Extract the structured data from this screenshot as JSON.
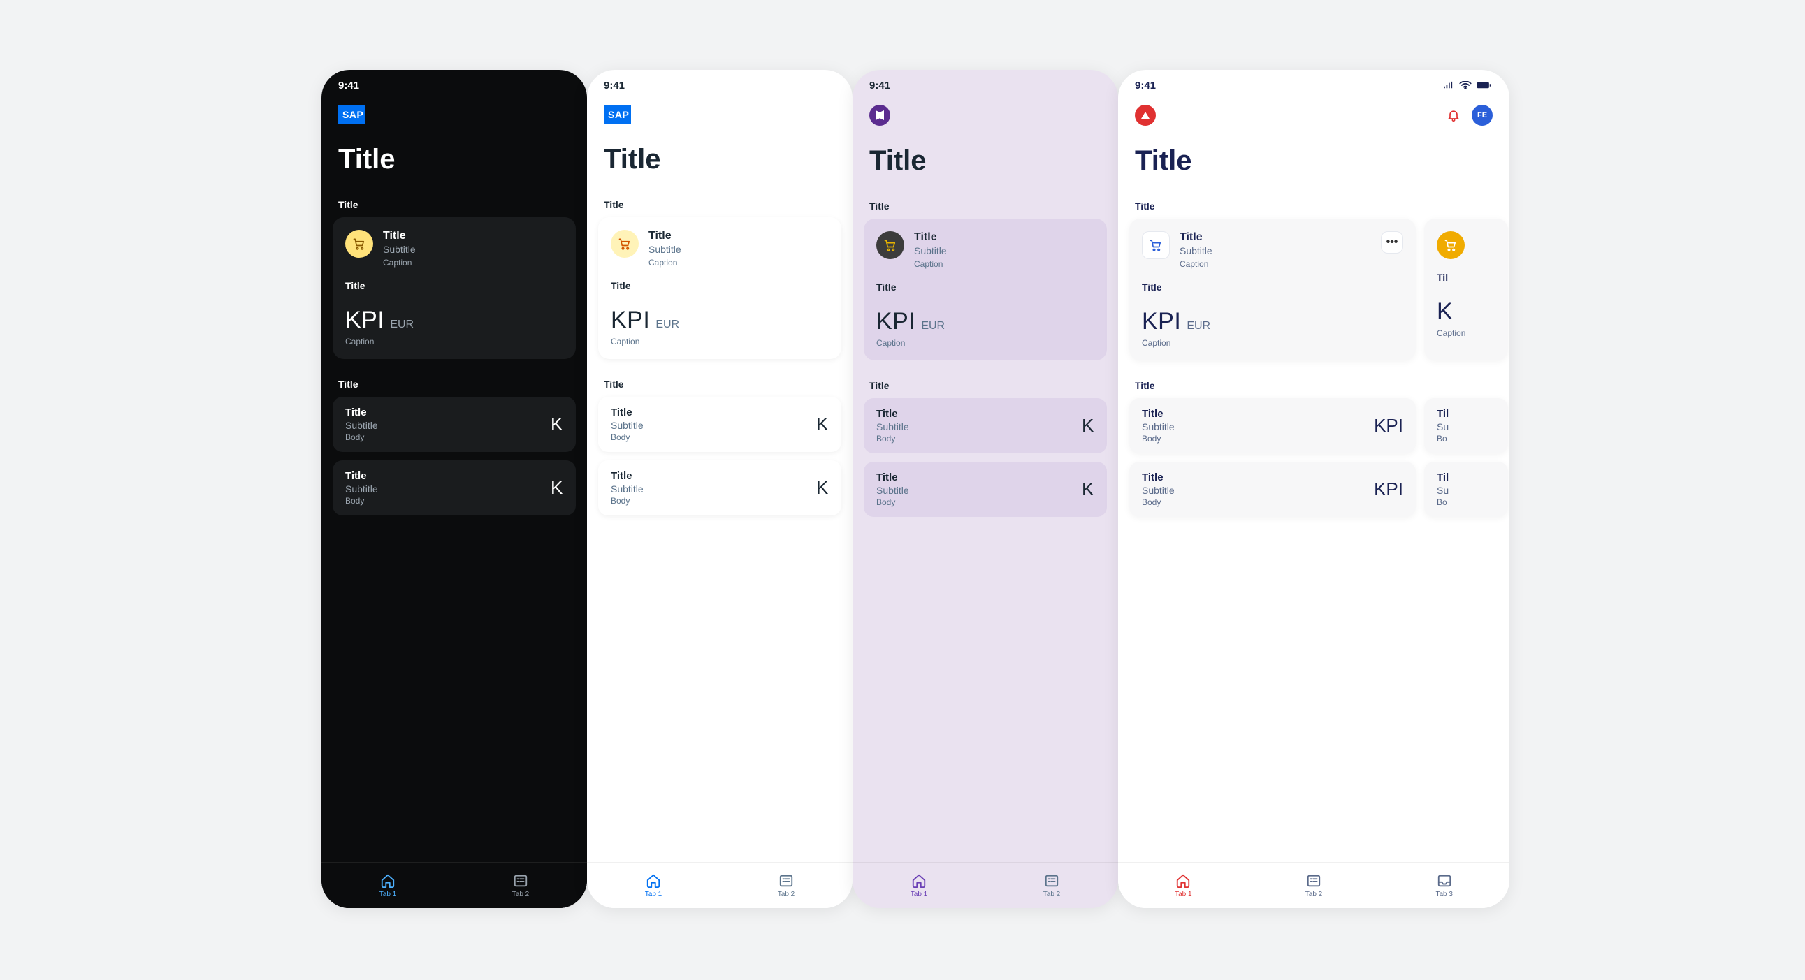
{
  "status_time": "9:41",
  "page_title": "Title",
  "avatar_initials": "FE",
  "logos": {
    "sap_text": "SAP"
  },
  "section1": {
    "title": "Title",
    "card": {
      "title": "Title",
      "subtitle": "Subtitle",
      "caption": "Caption"
    },
    "kpi": {
      "title": "Title",
      "value": "KPI",
      "unit": "EUR",
      "caption": "Caption"
    }
  },
  "section2": {
    "title": "Title",
    "items": [
      {
        "title": "Title",
        "subtitle": "Subtitle",
        "body": "Body",
        "kpi": "KPI"
      },
      {
        "title": "Title",
        "subtitle": "Subtitle",
        "body": "Body",
        "kpi": "KPI"
      }
    ]
  },
  "peek": {
    "title": "Til",
    "subtitle": "Su",
    "body": "Bo",
    "kpi_letter": "K"
  },
  "tabs2": [
    {
      "label": "Tab 1",
      "icon": "home",
      "active": true
    },
    {
      "label": "Tab 2",
      "icon": "list",
      "active": false
    }
  ],
  "tabs3": [
    {
      "label": "Tab 1",
      "icon": "home",
      "active": true
    },
    {
      "label": "Tab 2",
      "icon": "list",
      "active": false
    },
    {
      "label": "Tab 3",
      "icon": "inbox",
      "active": false
    }
  ]
}
